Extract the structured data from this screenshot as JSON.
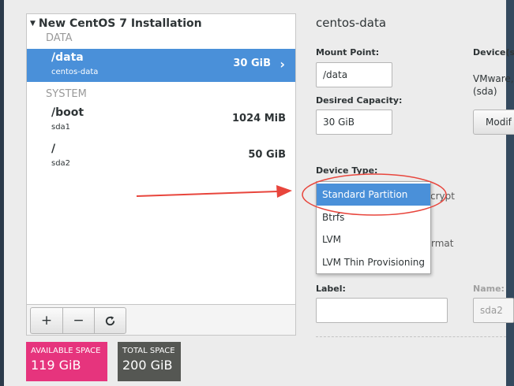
{
  "tree": {
    "title": "New CentOS 7 Installation",
    "groups": [
      {
        "label": "DATA"
      },
      {
        "label": "SYSTEM"
      }
    ],
    "mounts": [
      {
        "name": "/data",
        "device": "centos-data",
        "size": "30 GiB",
        "selected": true
      },
      {
        "name": "/boot",
        "device": "sda1",
        "size": "1024 MiB",
        "selected": false
      },
      {
        "name": "/",
        "device": "sda2",
        "size": "50 GiB",
        "selected": false
      }
    ],
    "toolbar": {
      "add": "+",
      "remove": "−",
      "refresh": "⟳"
    }
  },
  "space": {
    "available_label": "AVAILABLE SPACE",
    "available_value": "119 GiB",
    "total_label": "TOTAL SPACE",
    "total_value": "200 GiB"
  },
  "details": {
    "header": "centos-data",
    "mount_point_label": "Mount Point:",
    "mount_point_value": "/data",
    "capacity_label": "Desired Capacity:",
    "capacity_value": "30 GiB",
    "devices_label": "Device(s",
    "devices_text_line1": "VMware,",
    "devices_text_line2": "(sda)",
    "modify_label": "Modif",
    "device_type_label": "Device Type:",
    "encrypt_snippet": "crypt",
    "format_snippet": "rmat",
    "label_label": "Label:",
    "label_value": "",
    "name_label": "Name:",
    "name_value": "sda2"
  },
  "device_type_menu": {
    "options": [
      "Standard Partition",
      "Btrfs",
      "LVM",
      "LVM Thin Provisioning"
    ],
    "selected": "Standard Partition"
  },
  "colors": {
    "accent": "#4a90d9",
    "available": "#e6347d",
    "total": "#555753",
    "annotation": "#e8453c"
  }
}
